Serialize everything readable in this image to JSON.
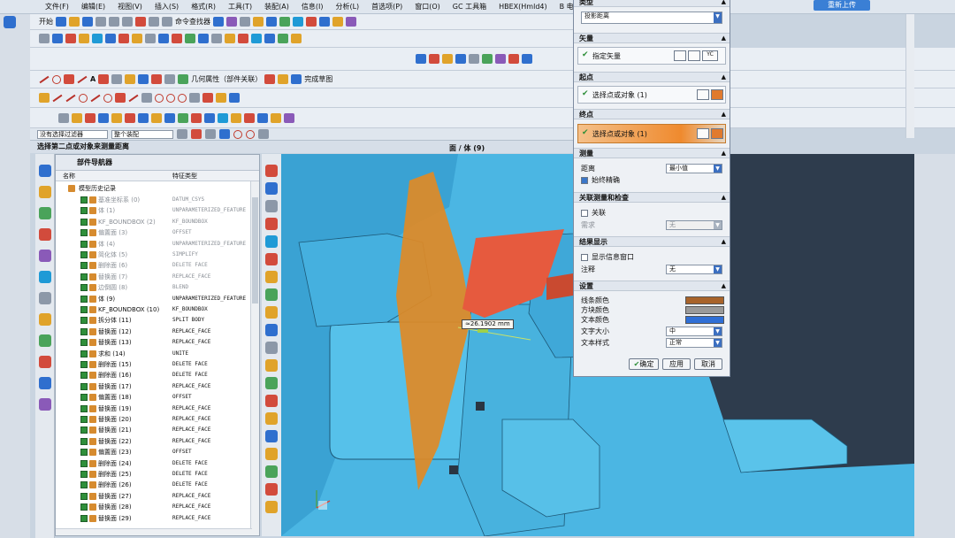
{
  "menu": [
    "文件(F)",
    "编辑(E)",
    "视图(V)",
    "插入(S)",
    "格式(R)",
    "工具(T)",
    "装配(A)",
    "信息(I)",
    "分析(L)",
    "首选项(P)",
    "窗口(O)",
    "GC 工具箱",
    "HBEX(Hmld4)",
    "B 电",
    "极",
    "帮助(H)",
    "HB_MOULD 8.8"
  ],
  "title_button": "重新上传",
  "toolbar": {
    "start": "开始",
    "command_finder": "命令查找器",
    "geom_props": "几何属性（部件关联）",
    "history_box": "完成草图"
  },
  "selection_bar": {
    "filter": "没有选择过滤器",
    "scope": "整个装配"
  },
  "status_text": "选择第二点或对象来测量距离",
  "graphics_title": "面 / 体 (9)",
  "navigator": {
    "title": "部件导航器",
    "col_name": "名称",
    "col_type": "特征类型",
    "root": "模型历史记录",
    "rows": [
      {
        "name": "基准坐标系 (0)",
        "type": "DATUM_CSYS",
        "dim": true
      },
      {
        "name": "体 (1)",
        "type": "UNPARAMETERIZED_FEATURE",
        "dim": true
      },
      {
        "name": "KF_BOUNDBOX (2)",
        "type": "KF_BOUNDBOX",
        "dim": true
      },
      {
        "name": "偏置面 (3)",
        "type": "OFFSET",
        "dim": true
      },
      {
        "name": "体 (4)",
        "type": "UNPARAMETERIZED_FEATURE",
        "dim": true
      },
      {
        "name": "简化体 (5)",
        "type": "SIMPLIFY",
        "dim": true
      },
      {
        "name": "删除面 (6)",
        "type": "DELETE FACE",
        "dim": true
      },
      {
        "name": "替换面 (7)",
        "type": "REPLACE_FACE",
        "dim": true
      },
      {
        "name": "边倒圆 (8)",
        "type": "BLEND",
        "dim": true
      },
      {
        "name": "体 (9)",
        "type": "UNPARAMETERIZED_FEATURE",
        "dim": false
      },
      {
        "name": "KF_BOUNDBOX (10)",
        "type": "KF_BOUNDBOX",
        "dim": false
      },
      {
        "name": "拆分体 (11)",
        "type": "SPLIT BODY",
        "dim": false
      },
      {
        "name": "替换面 (12)",
        "type": "REPLACE_FACE",
        "dim": false
      },
      {
        "name": "替换面 (13)",
        "type": "REPLACE_FACE",
        "dim": false
      },
      {
        "name": "求和 (14)",
        "type": "UNITE",
        "dim": false
      },
      {
        "name": "删除面 (15)",
        "type": "DELETE FACE",
        "dim": false
      },
      {
        "name": "删除面 (16)",
        "type": "DELETE FACE",
        "dim": false
      },
      {
        "name": "替换面 (17)",
        "type": "REPLACE_FACE",
        "dim": false
      },
      {
        "name": "偏置面 (18)",
        "type": "OFFSET",
        "dim": false
      },
      {
        "name": "替换面 (19)",
        "type": "REPLACE_FACE",
        "dim": false
      },
      {
        "name": "替换面 (20)",
        "type": "REPLACE_FACE",
        "dim": false
      },
      {
        "name": "替换面 (21)",
        "type": "REPLACE_FACE",
        "dim": false
      },
      {
        "name": "替换面 (22)",
        "type": "REPLACE_FACE",
        "dim": false
      },
      {
        "name": "偏置面 (23)",
        "type": "OFFSET",
        "dim": false
      },
      {
        "name": "删除面 (24)",
        "type": "DELETE FACE",
        "dim": false
      },
      {
        "name": "删除面 (25)",
        "type": "DELETE FACE",
        "dim": false
      },
      {
        "name": "删除面 (26)",
        "type": "DELETE FACE",
        "dim": false
      },
      {
        "name": "替换面 (27)",
        "type": "REPLACE_FACE",
        "dim": false
      },
      {
        "name": "替换面 (28)",
        "type": "REPLACE_FACE",
        "dim": false
      },
      {
        "name": "替换面 (29)",
        "type": "REPLACE_FACE",
        "dim": false
      }
    ]
  },
  "measure_label": "≈26.1902 mm",
  "dialog": {
    "type_section": "类型",
    "type_value": "投影距离",
    "vector_section": "矢量",
    "vector_label": "指定矢量",
    "vector_axis": "YC",
    "start_section": "起点",
    "start_label": "选择点或对象 (1)",
    "end_section": "终点",
    "end_label": "选择点或对象 (1)",
    "measure_section": "测量",
    "distance_label": "距离",
    "distance_value": "最小值",
    "always_align": "始终精确",
    "assoc_section": "关联测量和检查",
    "assoc_label": "关联",
    "req_label": "需求",
    "req_value": "无",
    "result_section": "结果显示",
    "show_info": "显示信息窗口",
    "note_label": "注释",
    "note_value": "无",
    "settings_section": "设置",
    "line_color": "线条颜色",
    "box_color": "方块颜色",
    "text_color": "文本颜色",
    "text_size_label": "文字大小",
    "text_size_value": "中",
    "text_style_label": "文本样式",
    "text_style_value": "正常",
    "ok": "确定",
    "apply": "应用",
    "cancel": "取消",
    "colors": {
      "line": "#a8632a",
      "box": "#9a9a9a",
      "text": "#2f6fd6"
    }
  },
  "colors": {
    "model": "#48b8e6",
    "plane": "#e08a25",
    "face": "#e65a3e",
    "background": "#2e3c4d"
  }
}
